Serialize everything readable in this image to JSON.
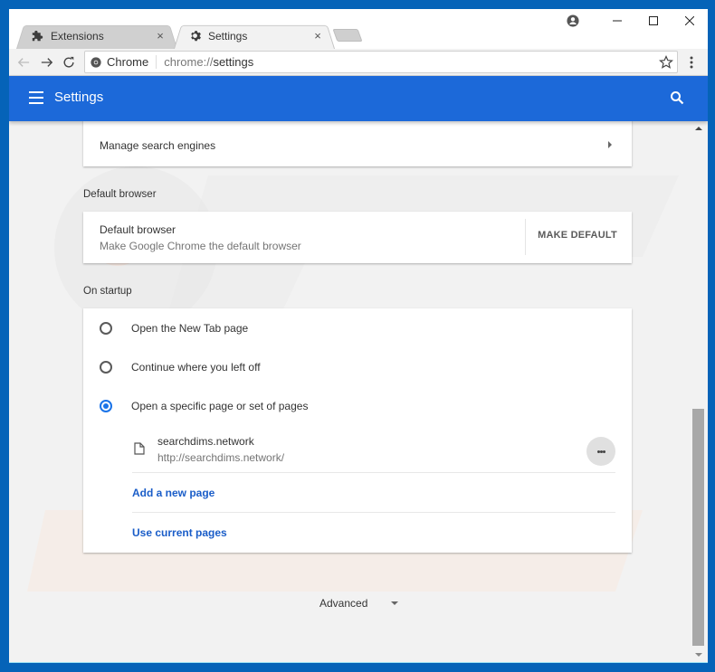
{
  "browser": {
    "tabs": [
      {
        "label": "Extensions",
        "icon": "puzzle-icon",
        "active": false
      },
      {
        "label": "Settings",
        "icon": "gear-icon",
        "active": true
      }
    ],
    "tab_close_glyph": "×",
    "window_controls": {
      "minimize": "–",
      "maximize": "☐",
      "close": "✕"
    },
    "omnibox": {
      "chip_label": "Chrome",
      "url_scheme": "chrome://",
      "url_path": "settings"
    }
  },
  "settings": {
    "header_title": "Settings",
    "search_engines": {
      "manage_label": "Manage search engines"
    },
    "default_browser": {
      "section_title": "Default browser",
      "title": "Default browser",
      "subtitle": "Make Google Chrome the default browser",
      "button_label": "MAKE DEFAULT"
    },
    "on_startup": {
      "section_title": "On startup",
      "options": [
        {
          "label": "Open the New Tab page",
          "checked": false
        },
        {
          "label": "Continue where you left off",
          "checked": false
        },
        {
          "label": "Open a specific page or set of pages",
          "checked": true
        }
      ],
      "pages": [
        {
          "name": "searchdims.network",
          "url": "http://searchdims.network/"
        }
      ],
      "add_page_label": "Add a new page",
      "use_current_label": "Use current pages"
    },
    "advanced_label": "Advanced"
  },
  "colors": {
    "header_blue": "#1c69d9",
    "link_blue": "#1a5dc8",
    "radio_blue": "#1a73e8",
    "window_border": "#0563b8"
  }
}
